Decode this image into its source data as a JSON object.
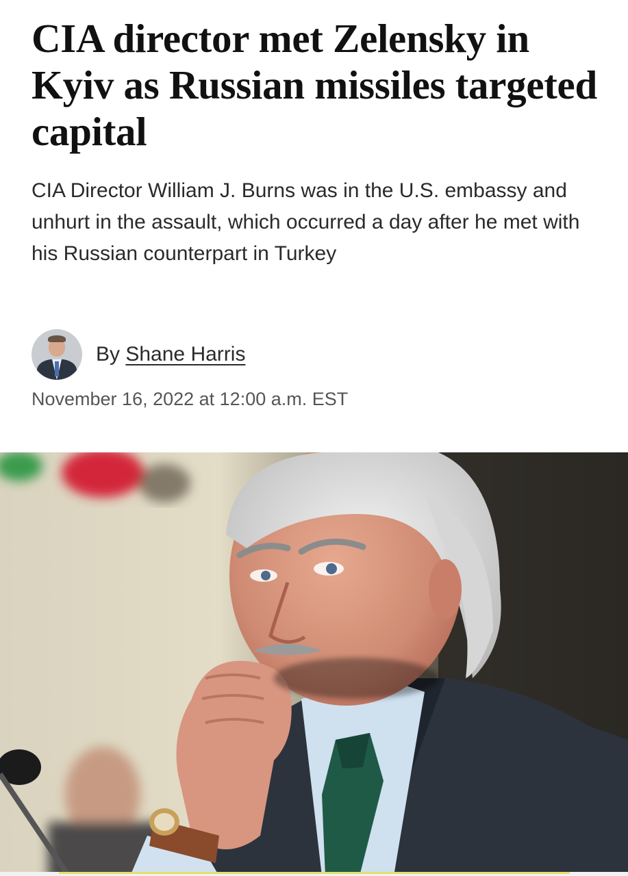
{
  "article": {
    "headline": "CIA director met Zelensky in Kyiv as Russian missiles targeted capital",
    "dek": "CIA Director William J. Burns was in the U.S. embassy and unhurt in the assault, which occurred a day after he met with his Russian counterpart in Turkey",
    "byline": {
      "prefix": "By ",
      "author": "Shane Harris"
    },
    "timestamp": "November 16, 2022 at 12:00 a.m. EST"
  },
  "icons": {
    "avatar": "author-avatar",
    "photo": "lead-photo"
  },
  "colors": {
    "text": "#111111",
    "secondary": "#555555",
    "accent_bar": "#e4e06a"
  }
}
